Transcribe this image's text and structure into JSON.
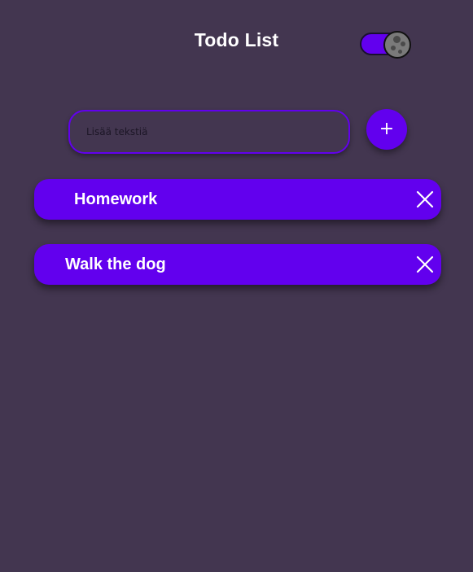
{
  "header": {
    "title": "Todo List",
    "theme_toggle": {
      "state": "on",
      "knob_icon": "moon-icon"
    }
  },
  "new_todo": {
    "placeholder": "Lisää tekstiä",
    "value": "",
    "add_label": "+"
  },
  "todos": [
    {
      "text": "Homework",
      "delete_icon": "close-icon"
    },
    {
      "text": "Walk the dog",
      "delete_icon": "close-icon"
    }
  ],
  "colors": {
    "background": "#433650",
    "accent": "#6200ee",
    "text": "#ffffff"
  }
}
